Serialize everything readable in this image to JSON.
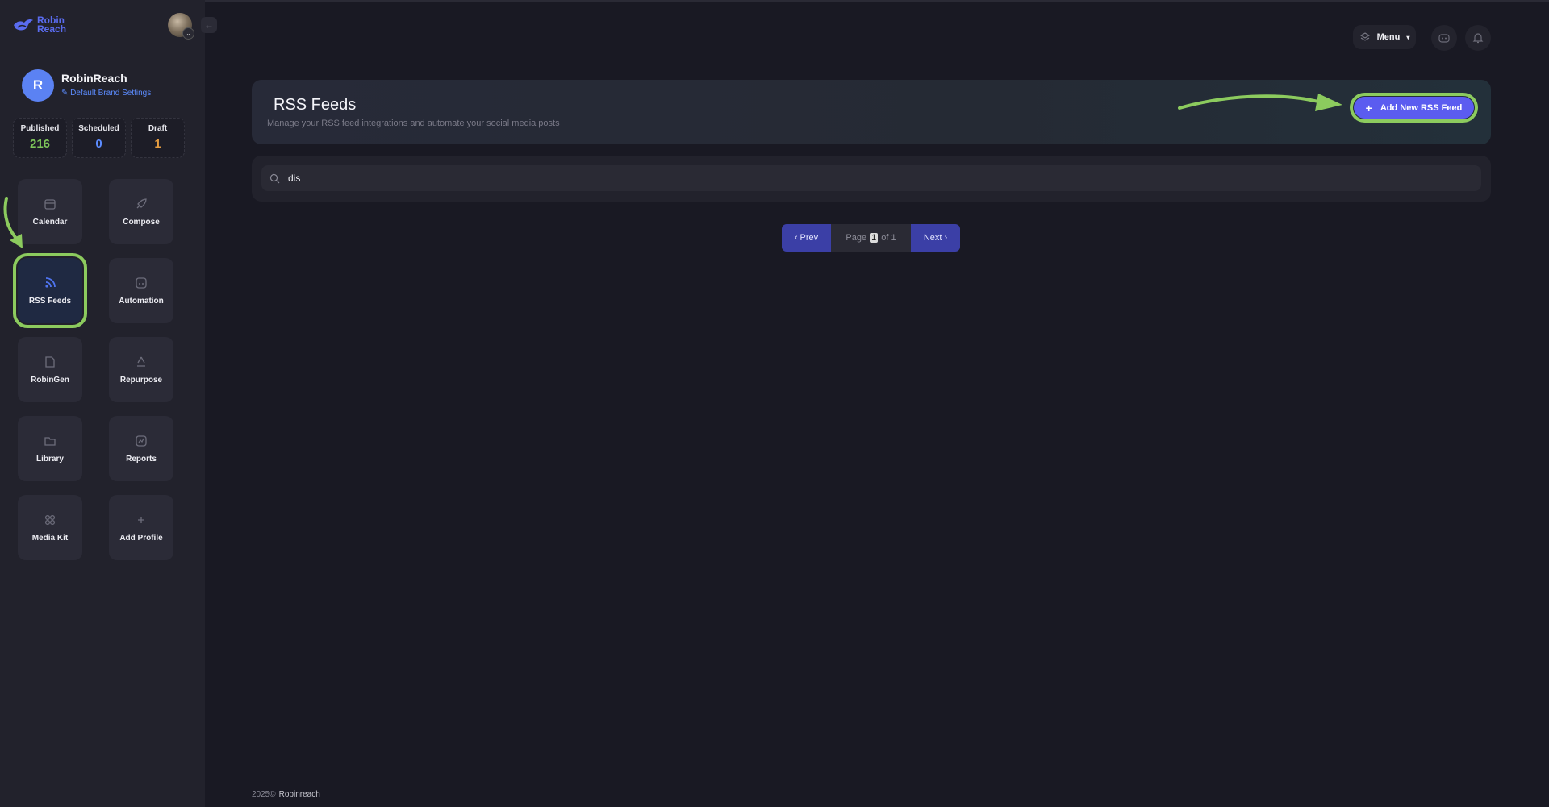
{
  "brand": {
    "logo_text": "Robin Reach",
    "logo_icon": "bird-icon"
  },
  "profile": {
    "initial": "R",
    "name": "RobinReach",
    "brand_settings_link": "Default Brand Settings"
  },
  "stats": [
    {
      "label": "Published",
      "value": "216",
      "color": "#7ec65a"
    },
    {
      "label": "Scheduled",
      "value": "0",
      "color": "#5c8cff"
    },
    {
      "label": "Draft",
      "value": "1",
      "color": "#e59c3f"
    }
  ],
  "nav": [
    {
      "label": "Calendar",
      "icon": "calendar-icon"
    },
    {
      "label": "Compose",
      "icon": "rocket-icon"
    },
    {
      "label": "RSS Feeds",
      "icon": "rss-icon",
      "active": true
    },
    {
      "label": "Automation",
      "icon": "automation-icon"
    },
    {
      "label": "RobinGen",
      "icon": "document-icon"
    },
    {
      "label": "Repurpose",
      "icon": "recycle-icon"
    },
    {
      "label": "Library",
      "icon": "folder-icon"
    },
    {
      "label": "Reports",
      "icon": "chart-icon"
    },
    {
      "label": "Media Kit",
      "icon": "grid-icon"
    },
    {
      "label": "Add Profile",
      "icon": "plus-icon"
    }
  ],
  "topbar": {
    "menu_label": "Menu"
  },
  "header": {
    "title": "RSS Feeds",
    "subtitle": "Manage your RSS feed integrations and automate your social media posts",
    "add_button": "Add New RSS Feed"
  },
  "search": {
    "value": "dis"
  },
  "pagination": {
    "prev": "‹ Prev",
    "page_label": "Page",
    "current": "1",
    "of_label": "of 1",
    "next": "Next ›"
  },
  "footer": {
    "year": "2025©",
    "company": "Robinreach"
  },
  "colors": {
    "accent": "#5b5cf0",
    "highlight": "#8ccb5e"
  }
}
